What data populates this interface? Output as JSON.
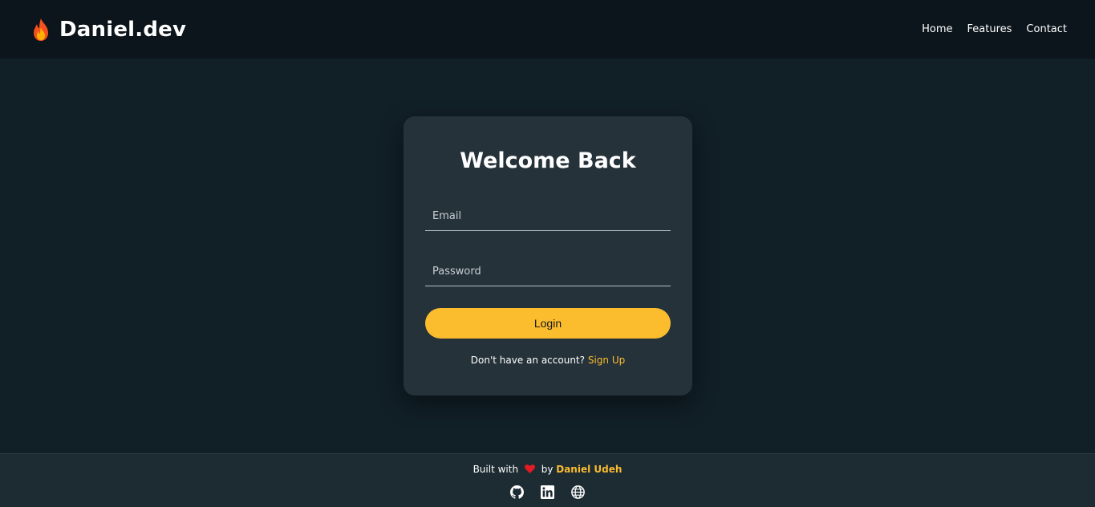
{
  "header": {
    "brand_name": "Daniel.dev",
    "brand_icon": "flame-icon",
    "nav": [
      {
        "label": "Home"
      },
      {
        "label": "Features"
      },
      {
        "label": "Contact"
      }
    ]
  },
  "login_card": {
    "title": "Welcome Back",
    "email_placeholder": "Email",
    "password_placeholder": "Password",
    "login_label": "Login",
    "signup_prompt": "Don't have an account?",
    "signup_link": "Sign Up"
  },
  "footer": {
    "built_with": "Built with",
    "by": "by",
    "author": "Daniel Udeh",
    "heart_icon": "heart-icon",
    "socials": [
      {
        "icon": "github-icon"
      },
      {
        "icon": "linkedin-icon"
      },
      {
        "icon": "globe-icon"
      }
    ]
  },
  "colors": {
    "background": "#111f27",
    "header": "#0b151b",
    "card": "#25323a",
    "accent": "#fbbc2e",
    "footer": "#1d2b33",
    "heart": "#e31b23"
  }
}
